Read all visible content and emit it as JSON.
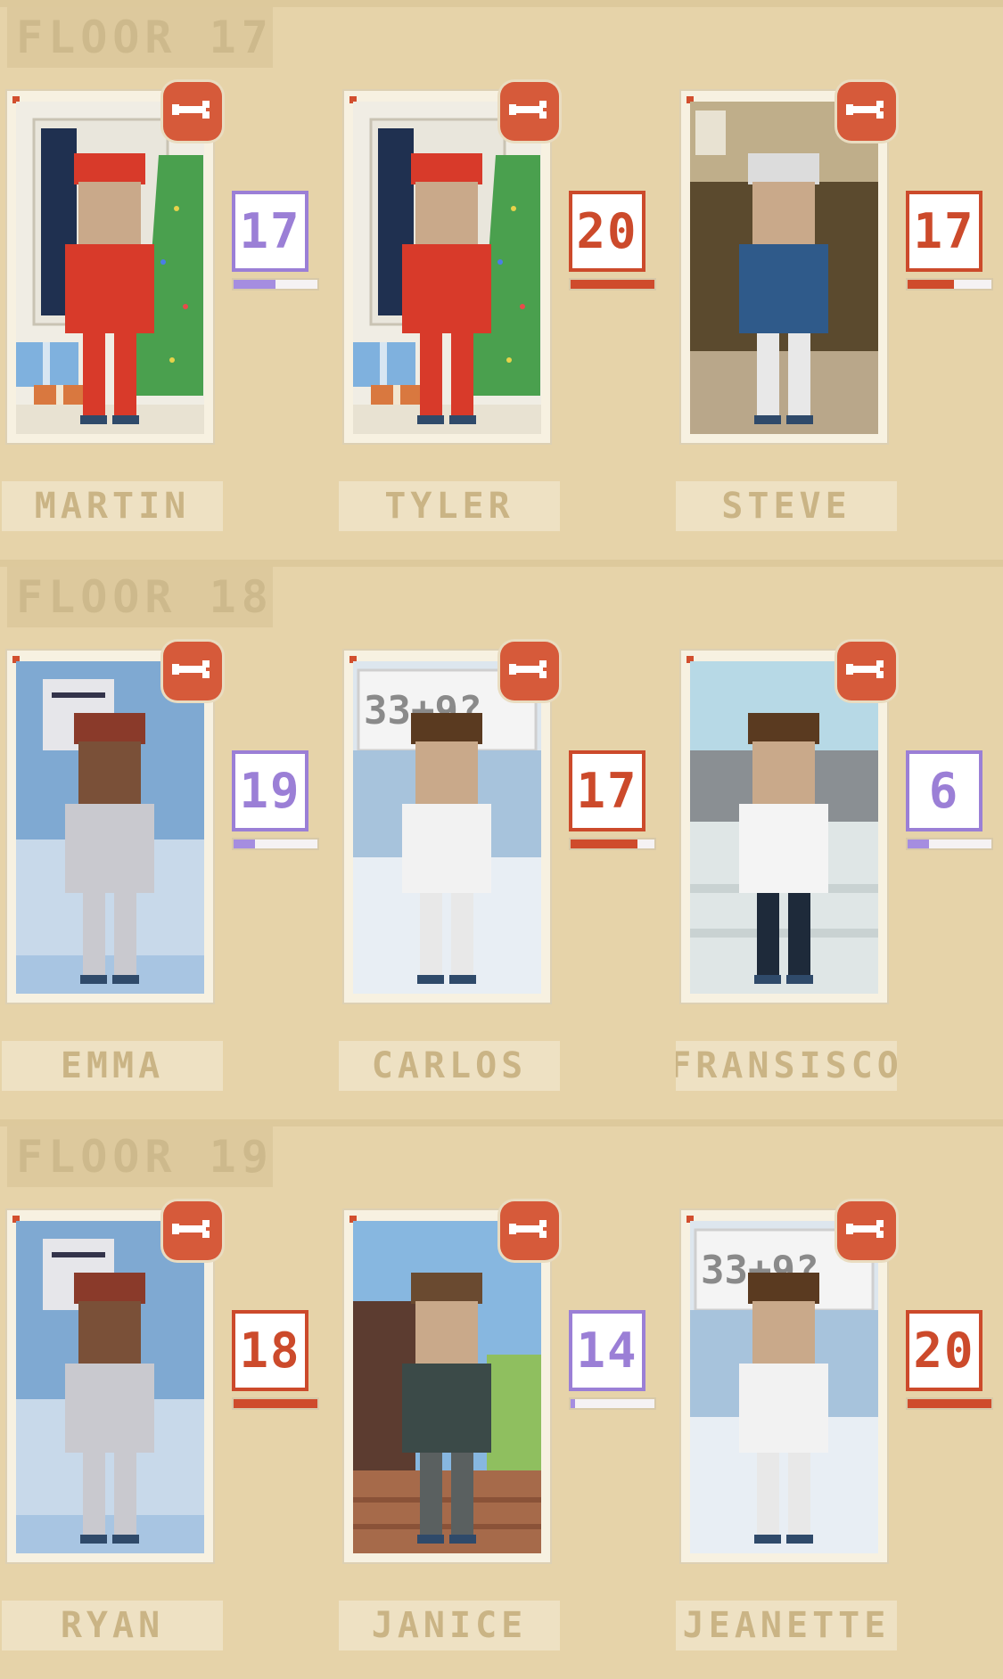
{
  "floors": [
    {
      "title": "FLOOR 17",
      "residents": [
        {
          "name": "MARTIN",
          "level": "17",
          "level_color": "purple",
          "progress": 0.5,
          "scene": "christmas",
          "outfit": "santa"
        },
        {
          "name": "TYLER",
          "level": "20",
          "level_color": "red",
          "progress": 1.0,
          "scene": "christmas",
          "outfit": "santa"
        },
        {
          "name": "STEVE",
          "level": "17",
          "level_color": "red",
          "progress": 0.55,
          "scene": "office-brown",
          "outfit": "suit"
        }
      ]
    },
    {
      "title": "FLOOR 18",
      "residents": [
        {
          "name": "EMMA",
          "level": "19",
          "level_color": "purple",
          "progress": 0.25,
          "scene": "clinic-blue",
          "outfit": "gown"
        },
        {
          "name": "CARLOS",
          "level": "17",
          "level_color": "red",
          "progress": 0.8,
          "scene": "classroom",
          "outfit": "labcoat"
        },
        {
          "name": "FRANSISCO",
          "level": "6",
          "level_color": "purple",
          "progress": 0.25,
          "scene": "airport",
          "outfit": "pilot"
        }
      ]
    },
    {
      "title": "FLOOR 19",
      "residents": [
        {
          "name": "RYAN",
          "level": "18",
          "level_color": "red",
          "progress": 1.0,
          "scene": "clinic-blue",
          "outfit": "gown"
        },
        {
          "name": "JANICE",
          "level": "14",
          "level_color": "purple",
          "progress": 0.05,
          "scene": "outdoor",
          "outfit": "sweater"
        },
        {
          "name": "JEANETTE",
          "level": "20",
          "level_color": "red",
          "progress": 1.0,
          "scene": "classroom",
          "outfit": "labcoat"
        }
      ]
    }
  ],
  "board_text": "33+9?",
  "icons": {
    "remove": "wrench-icon"
  },
  "colors": {
    "background": "#e6d3a9",
    "purple": "#9b7fd6",
    "red": "#cc4a2b",
    "remove_button": "#d65a3a"
  }
}
